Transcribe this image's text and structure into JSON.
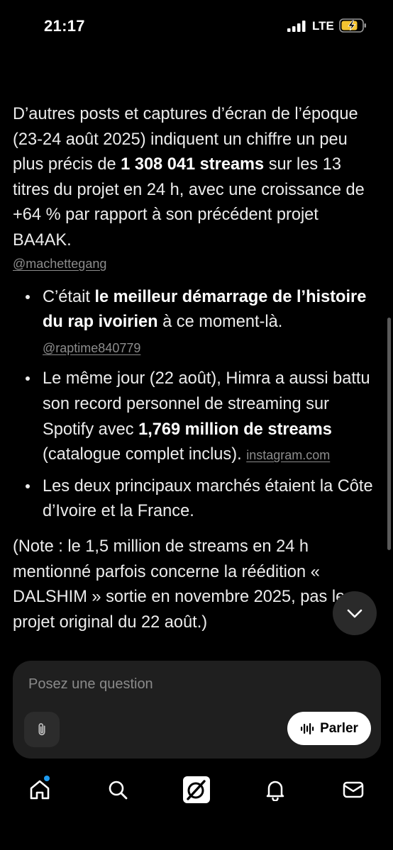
{
  "status_bar": {
    "time": "21:17",
    "network": "LTE",
    "icons": [
      "signal-icon",
      "battery-charging-icon"
    ]
  },
  "article": {
    "paragraph1": {
      "text_a": "D’autres posts et captures d’écran de l’époque (23-24 août 2025) indiquent un chiffre un peu plus précis de ",
      "bold_a": "1 308 041 streams",
      "text_b": " sur les 13 titres du projet en 24 h, avec une croissance de +64 % par rapport à son précédent projet BA4AK.",
      "source": "@machettegang"
    },
    "bullets": [
      {
        "text_a": "C’était ",
        "bold": "le meilleur démarrage de l’histoire du rap ivoirien",
        "text_b": " à ce moment-là. ",
        "source": "@raptime840779"
      },
      {
        "text_a": "Le même jour (22 août), Himra a aussi battu son record personnel de streaming sur Spotify avec ",
        "bold": "1,769 million de streams",
        "text_b": " (catalogue complet inclus). ",
        "source": "instagram.com"
      },
      {
        "text_a": "Les deux principaux marchés étaient la Côte d’Ivoire et la France.",
        "bold": "",
        "text_b": "",
        "source": ""
      }
    ],
    "note": "(Note : le 1,5 million de streams en 24 h mentionné parfois concerne la réédition « DALSHIM » sortie en novembre 2025, pas le projet original du 22 août.)"
  },
  "composer": {
    "placeholder": "Posez une question",
    "value": "",
    "speak_label": "Parler",
    "icons": [
      "paperclip-icon",
      "waveform-icon"
    ]
  },
  "bottom_nav": {
    "items": [
      "home-icon",
      "search-icon",
      "grok-icon",
      "bell-icon",
      "mail-icon"
    ],
    "home_has_notification": true
  },
  "colors": {
    "background": "#000000",
    "text": "#ececec",
    "link": "#8c8c8c",
    "card": "#1f1f1f",
    "notification_dot": "#1d9bf0"
  }
}
